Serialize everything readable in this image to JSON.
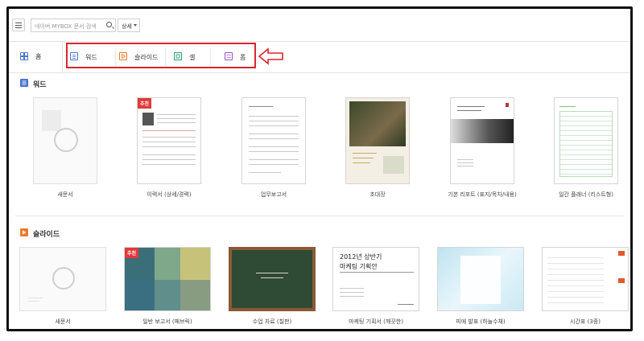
{
  "search": {
    "placeholder": "네이버 MYBOX 문서 검색"
  },
  "detail_label": "상세",
  "tabs": {
    "home": "홈",
    "word": "워드",
    "slide": "슬라이드",
    "cell": "셀",
    "form": "폼"
  },
  "colors": {
    "word": "#4a76c9",
    "slide": "#ee7a2c",
    "cell": "#2a9d6b",
    "form": "#9b4fd0",
    "highlight": "#d8262d"
  },
  "word_section": {
    "title": "워드",
    "templates": [
      {
        "caption": "새문서"
      },
      {
        "caption": "이력서 (상세/경력)",
        "badge": "추천"
      },
      {
        "caption": "업무보고서"
      },
      {
        "caption": "초대장"
      },
      {
        "caption": "기본 리포트 (표지/목차/내용)"
      },
      {
        "caption": "일간 플래너 (리스트형)"
      }
    ]
  },
  "slide_section": {
    "title": "슬라이드",
    "templates": [
      {
        "caption": "새문서"
      },
      {
        "caption": "일반 보고서 (패브릭)",
        "badge": "추천"
      },
      {
        "caption": "수업 자료 (칠판)"
      },
      {
        "caption": "마케팅 기획서 (깨끗한)",
        "thumb_text": [
          "2012년 상반기",
          "마케팅 기획안"
        ]
      },
      {
        "caption": "피에 발표 (하늘수채)"
      },
      {
        "caption": "시간표 (3종)"
      }
    ]
  }
}
